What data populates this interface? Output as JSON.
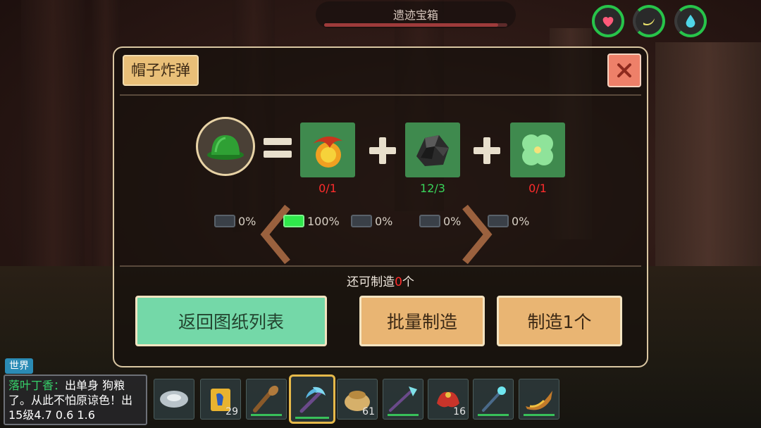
{
  "target": {
    "name": "遗迹宝箱",
    "hp_fraction": 0.95
  },
  "status_icons": [
    {
      "name": "health",
      "icon": "heart-icon",
      "color": "#ff5a7a",
      "fill": 1.0
    },
    {
      "name": "hunger",
      "icon": "banana-icon",
      "color": "#e8e06a",
      "fill": 0.85
    },
    {
      "name": "thirst",
      "icon": "water-drop-icon",
      "color": "#4fd6e8",
      "fill": 0.85
    }
  ],
  "craft": {
    "title": "帽子炸弹",
    "result_icon": "green-helmet-icon",
    "ingredients": [
      {
        "icon": "fire-fruit-icon",
        "count": "0/1",
        "count_color": "#ff2c2c"
      },
      {
        "icon": "coal-ore-icon",
        "count": "12/3",
        "count_color": "#39d45a"
      },
      {
        "icon": "four-leaf-clover-icon",
        "count": "0/1",
        "count_color": "#ff2c2c"
      }
    ],
    "pages": [
      "0%",
      "100%",
      "0%",
      "0%",
      "0%"
    ],
    "active_page": 1,
    "remain_prefix": "还可制造",
    "remain_count": "0",
    "remain_suffix": "个",
    "buttons": {
      "back": "返回图纸列表",
      "batch": "批量制造",
      "one": "制造1个"
    }
  },
  "chat": {
    "channel": "世界",
    "sender": "落叶丁香",
    "separator": "：",
    "message": "出单身 狗粮了。从此不怕原谅色！出15级4.7 0.6 1.6"
  },
  "hotbar": [
    {
      "icon": "stone-disc-icon",
      "count": "",
      "durability": false
    },
    {
      "icon": "horse-feed-bag-icon",
      "count": "29",
      "durability": false
    },
    {
      "icon": "wooden-club-icon",
      "count": "",
      "durability": true
    },
    {
      "icon": "crystal-pickaxe-icon",
      "count": "",
      "durability": true,
      "selected": true
    },
    {
      "icon": "seed-bag-icon",
      "count": "61",
      "durability": false
    },
    {
      "icon": "crystal-spear-icon",
      "count": "",
      "durability": true
    },
    {
      "icon": "red-saddle-icon",
      "count": "16",
      "durability": false
    },
    {
      "icon": "crystal-staff-icon",
      "count": "",
      "durability": true
    },
    {
      "icon": "horn-icon",
      "count": "",
      "durability": true
    }
  ]
}
